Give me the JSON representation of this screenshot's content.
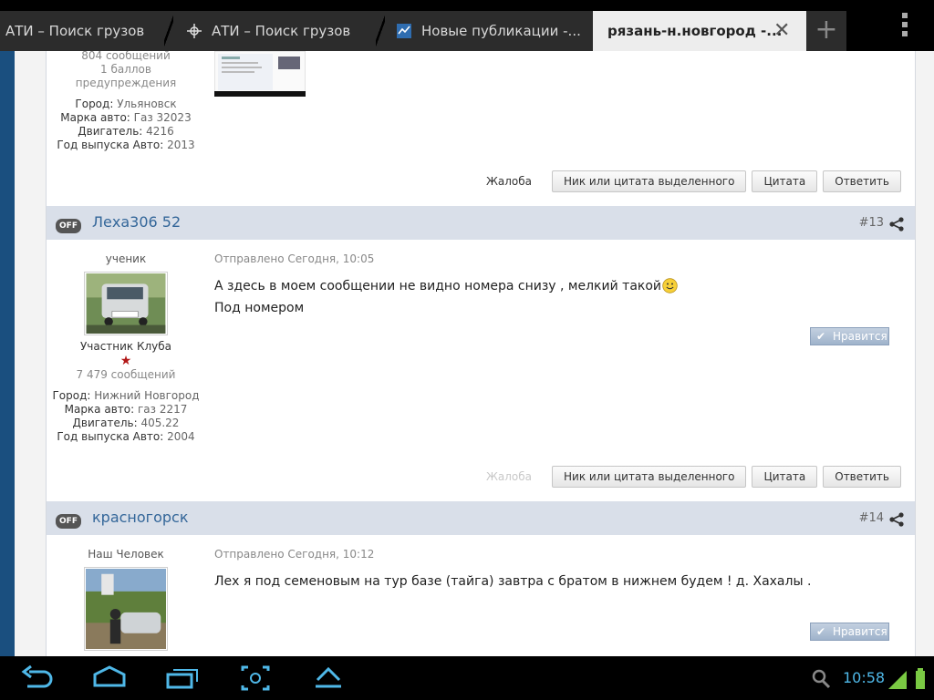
{
  "browser": {
    "tabs": [
      {
        "label": "АТИ – Поиск грузов",
        "active": false
      },
      {
        "label": "АТИ – Поиск грузов",
        "active": false
      },
      {
        "label": "Новые публикации -...",
        "active": false
      },
      {
        "label": "рязань-н.новгород -...",
        "active": true
      }
    ],
    "close_glyph": "✕",
    "new_tab_glyph": "+"
  },
  "prev_post": {
    "stats_messages": "804 сообщений",
    "stats_points": "1 баллов",
    "stats_warnings": "предупреждения",
    "city_label": "Город:",
    "city": "Ульяновск",
    "car_label": "Марка авто:",
    "car": "Газ 32023",
    "engine_label": "Двигатель:",
    "engine": "4216",
    "year_label": "Год выпуска Авто:",
    "year": "2013",
    "actions": {
      "complaint": "Жалоба",
      "quote_selected": "Ник или цитата выделенного",
      "quote": "Цитата",
      "reply": "Ответить"
    }
  },
  "posts": [
    {
      "status": "OFF",
      "author": "Леха306 52",
      "number": "#13",
      "rank": "ученик",
      "group": "Участник Клуба",
      "messages": "7 479 сообщений",
      "city_label": "Город:",
      "city": "Нижний Новгород",
      "car_label": "Марка авто:",
      "car": "газ 2217",
      "engine_label": "Двигатель:",
      "engine": "405.22",
      "year_label": "Год выпуска Авто:",
      "year": "2004",
      "sent": "Отправлено Сегодня, 10:05",
      "body_line1": "А здесь в моем сообщении не видно номера снизу , мелкий такой",
      "body_line2": "Под номером",
      "like": "Нравится",
      "actions": {
        "complaint": "Жалоба",
        "quote_selected": "Ник или цитата выделенного",
        "quote": "Цитата",
        "reply": "Ответить"
      }
    },
    {
      "status": "OFF",
      "author": "красногорск",
      "number": "#14",
      "rank": "Наш Человек",
      "sent": "Отправлено Сегодня, 10:12",
      "body_line1": "Лех я под семеновым на тур базе (тайга) завтра с братом в нижнем будем ! д. Хахалы .",
      "like": "Нравится"
    }
  ],
  "system": {
    "clock": "10:58",
    "accent": "#4fb8e8"
  }
}
